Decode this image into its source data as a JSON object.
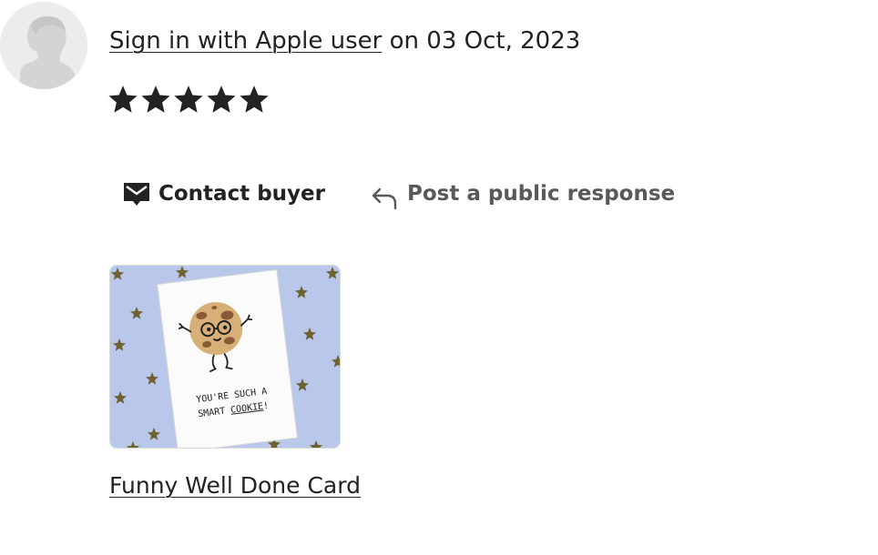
{
  "review": {
    "reviewer_name": "Sign in with Apple user",
    "date_text": "on 03 Oct, 2023",
    "rating": 5,
    "rating_max": 5,
    "star_color": "#222222"
  },
  "actions": {
    "contact_label": "Contact buyer",
    "contact_icon": "envelope-message-icon",
    "respond_label": "Post a public response",
    "respond_icon": "reply-arrow-icon",
    "respond_color": "#595959"
  },
  "product": {
    "card_text_line1": "YOU'RE SUCH A",
    "card_text_line2_prefix": "SMART ",
    "card_text_line2_emph": "COOKIE",
    "card_text_line2_suffix": "!",
    "background_color": "#b9c8ea",
    "link_label": "Funny Well Done Card"
  }
}
